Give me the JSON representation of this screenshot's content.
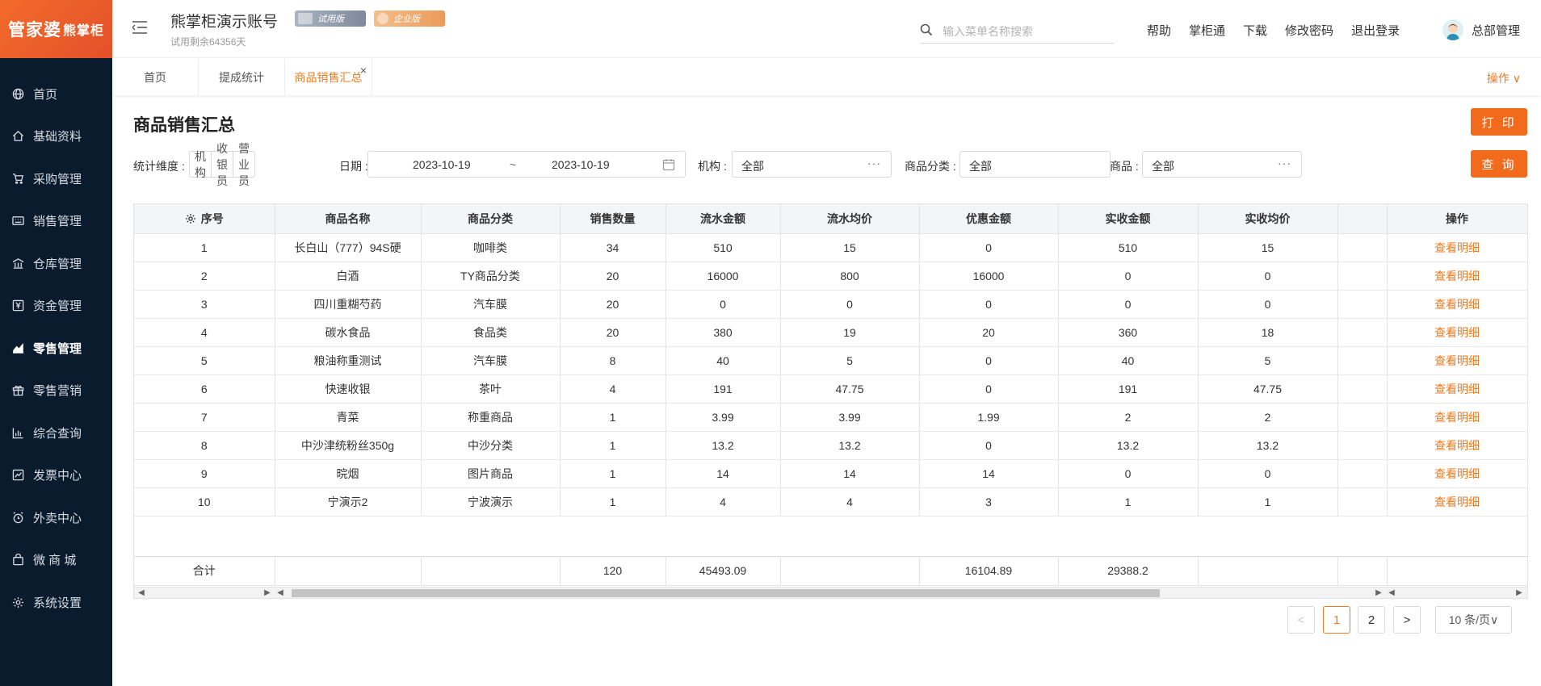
{
  "sidebar": {
    "logo_main": "管家婆",
    "logo_sub": "熊掌柜",
    "items": [
      {
        "label": "首页",
        "icon": "globe-icon",
        "active": false
      },
      {
        "label": "基础资料",
        "icon": "home-icon",
        "active": false
      },
      {
        "label": "采购管理",
        "icon": "cart-icon",
        "active": false
      },
      {
        "label": "销售管理",
        "icon": "keyboard-icon",
        "active": false
      },
      {
        "label": "仓库管理",
        "icon": "warehouse-icon",
        "active": false
      },
      {
        "label": "资金管理",
        "icon": "money-icon",
        "active": false
      },
      {
        "label": "零售管理",
        "icon": "chart-line-icon",
        "active": true
      },
      {
        "label": "零售营销",
        "icon": "gift-icon",
        "active": false
      },
      {
        "label": "综合查询",
        "icon": "bar-chart-icon",
        "active": false
      },
      {
        "label": "发票中心",
        "icon": "invoice-icon",
        "active": false
      },
      {
        "label": "外卖中心",
        "icon": "alarm-icon",
        "active": false
      },
      {
        "label": "微 商 城",
        "icon": "bag-icon",
        "active": false
      },
      {
        "label": "系统设置",
        "icon": "gear-icon",
        "active": false
      }
    ]
  },
  "header": {
    "account_name": "熊掌柜演示账号",
    "badge_trial": "试用版",
    "badge_enterprise": "企业版",
    "trial_remaining": "试用剩余64356天",
    "search_placeholder": "输入菜单名称搜索",
    "links": [
      "帮助",
      "掌柜通",
      "下载",
      "修改密码",
      "退出登录"
    ],
    "user_name": "总部管理"
  },
  "tabs": {
    "items": [
      {
        "label": "首页",
        "active": false
      },
      {
        "label": "提成统计",
        "active": false
      },
      {
        "label": "商品销售汇总",
        "active": true
      }
    ],
    "close_symbol": "×",
    "operations_label": "操作 ∨"
  },
  "page": {
    "title": "商品销售汇总",
    "print_label": "打 印",
    "query_label": "查 询"
  },
  "filters": {
    "dimension_label": "统计维度 :",
    "dimension_options": [
      "机构",
      "收银员",
      "营业员"
    ],
    "date_label": "日期 :",
    "date_start": "2023-10-19",
    "date_separator": "~",
    "date_end": "2023-10-19",
    "org_label": "机构 :",
    "org_value": "全部",
    "category_label": "商品分类 :",
    "category_value": "全部",
    "product_label": "商品 :",
    "product_value": "全部",
    "more_symbol": "···"
  },
  "table": {
    "columns": [
      "序号",
      "商品名称",
      "商品分类",
      "销售数量",
      "流水金额",
      "流水均价",
      "优惠金额",
      "实收金额",
      "实收均价",
      "",
      "操作"
    ],
    "rows": [
      [
        "1",
        "长白山（777）94S硬",
        "咖啡类",
        "34",
        "510",
        "15",
        "0",
        "510",
        "15",
        "",
        "查看明细"
      ],
      [
        "2",
        "白酒",
        "TY商品分类",
        "20",
        "16000",
        "800",
        "16000",
        "0",
        "0",
        "",
        "查看明细"
      ],
      [
        "3",
        "四川重糊芍药",
        "汽车膜",
        "20",
        "0",
        "0",
        "0",
        "0",
        "0",
        "",
        "查看明细"
      ],
      [
        "4",
        "碳水食品",
        "食品类",
        "20",
        "380",
        "19",
        "20",
        "360",
        "18",
        "",
        "查看明细"
      ],
      [
        "5",
        "粮油称重测试",
        "汽车膜",
        "8",
        "40",
        "5",
        "0",
        "40",
        "5",
        "",
        "查看明细"
      ],
      [
        "6",
        "快速收银",
        "茶叶",
        "4",
        "191",
        "47.75",
        "0",
        "191",
        "47.75",
        "",
        "查看明细"
      ],
      [
        "7",
        "青菜",
        "称重商品",
        "1",
        "3.99",
        "3.99",
        "1.99",
        "2",
        "2",
        "",
        "查看明细"
      ],
      [
        "8",
        "中沙津统粉丝350g",
        "中沙分类",
        "1",
        "13.2",
        "13.2",
        "0",
        "13.2",
        "13.2",
        "",
        "查看明细"
      ],
      [
        "9",
        "晥烟",
        "图片商品",
        "1",
        "14",
        "14",
        "14",
        "0",
        "0",
        "",
        "查看明细"
      ],
      [
        "10",
        "宁演示2",
        "宁波演示",
        "1",
        "4",
        "4",
        "3",
        "1",
        "1",
        "",
        "查看明细"
      ]
    ],
    "total": [
      "合计",
      "",
      "",
      "120",
      "45493.09",
      "",
      "16104.89",
      "29388.2",
      "",
      "",
      ""
    ]
  },
  "pagination": {
    "prev": "<",
    "pages": [
      "1",
      "2"
    ],
    "current": "1",
    "next": ">",
    "page_size": "10 条/页∨"
  },
  "colors": {
    "accent": "#f07a20",
    "sidebar_bg": "#0a1b2e"
  }
}
